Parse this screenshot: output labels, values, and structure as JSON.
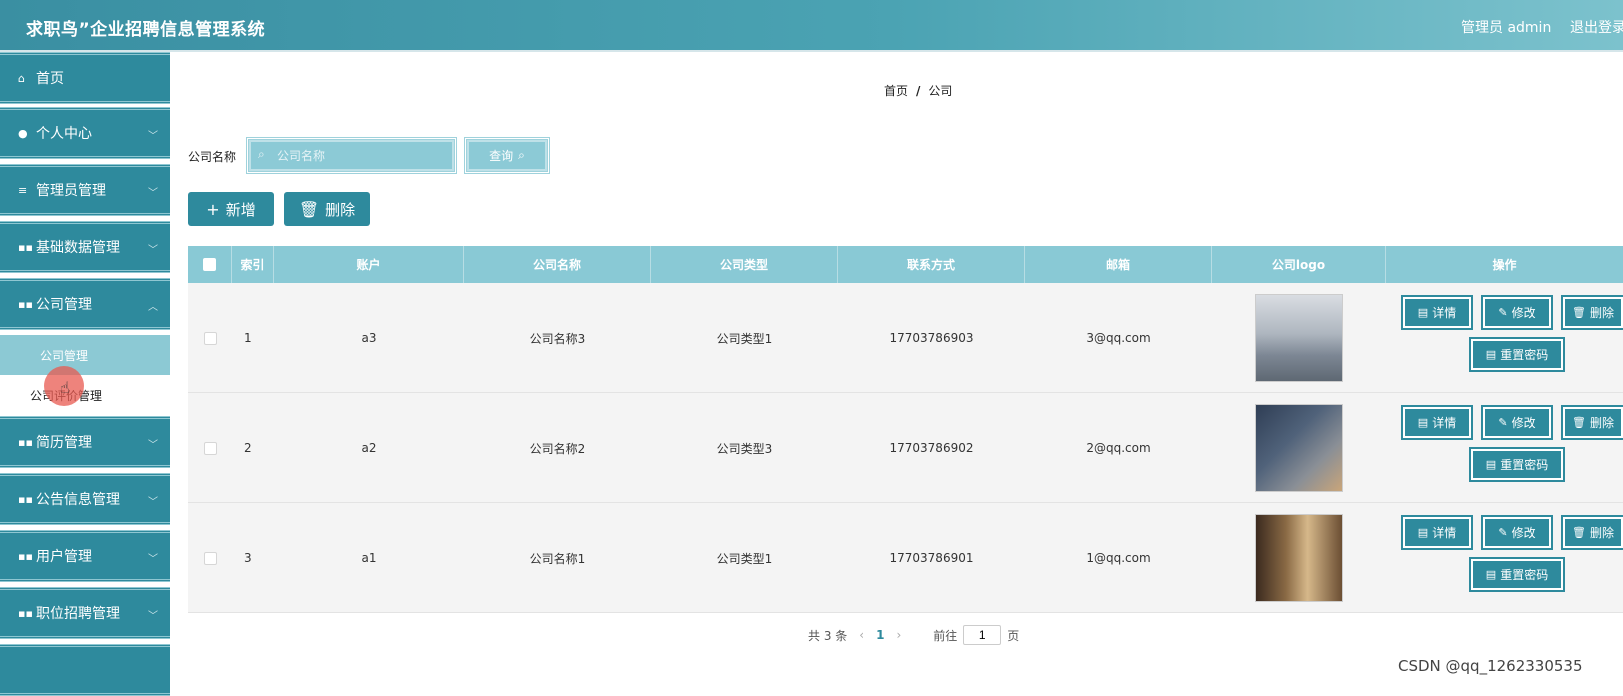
{
  "header": {
    "app_title": "求职鸟”企业招聘信息管理系统",
    "user_label": "管理员 admin",
    "logout_label": "退出登录"
  },
  "sidebar": {
    "items": [
      {
        "label": "首页",
        "icon": "home-icon"
      },
      {
        "label": "个人中心",
        "icon": "user-icon"
      },
      {
        "label": "管理员管理",
        "icon": "list-icon"
      },
      {
        "label": "基础数据管理",
        "icon": "grid-icon"
      },
      {
        "label": "公司管理",
        "icon": "grid-icon"
      },
      {
        "label": "简历管理",
        "icon": "grid-icon"
      },
      {
        "label": "公告信息管理",
        "icon": "grid-icon"
      },
      {
        "label": "用户管理",
        "icon": "grid-icon"
      },
      {
        "label": "职位招聘管理",
        "icon": "grid-icon"
      }
    ],
    "sub_items": [
      {
        "label": "公司管理",
        "active": true
      },
      {
        "label": "公司评价管理",
        "active": false
      }
    ]
  },
  "breadcrumb": {
    "home": "首页",
    "separator": "/",
    "current": "公司"
  },
  "search": {
    "label": "公司名称",
    "placeholder": "公司名称",
    "value": "",
    "button_label": "查询"
  },
  "toolbar": {
    "add_label": "新增",
    "delete_label": "删除"
  },
  "table": {
    "columns": [
      "",
      "索引",
      "账户",
      "公司名称",
      "公司类型",
      "联系方式",
      "邮箱",
      "公司logo",
      "操作"
    ],
    "rows": [
      {
        "index": "1",
        "account": "a3",
        "company_name": "公司名称3",
        "company_type": "公司类型1",
        "contact": "17703786903",
        "email": "3@qq.com"
      },
      {
        "index": "2",
        "account": "a2",
        "company_name": "公司名称2",
        "company_type": "公司类型3",
        "contact": "17703786902",
        "email": "2@qq.com"
      },
      {
        "index": "3",
        "account": "a1",
        "company_name": "公司名称1",
        "company_type": "公司类型1",
        "contact": "17703786901",
        "email": "1@qq.com"
      }
    ],
    "row_actions": {
      "detail": "详情",
      "edit": "修改",
      "delete": "删除",
      "reset_password": "重置密码"
    }
  },
  "pagination": {
    "total_text": "共 3 条",
    "current_page": "1",
    "goto_label": "前往",
    "goto_value": "1",
    "page_suffix": "页"
  },
  "watermark": "CSDN @qq_1262330535",
  "colors": {
    "primary": "#2e8a9d",
    "table_header": "#89c9d5",
    "sub_active": "#8cc9d4"
  }
}
